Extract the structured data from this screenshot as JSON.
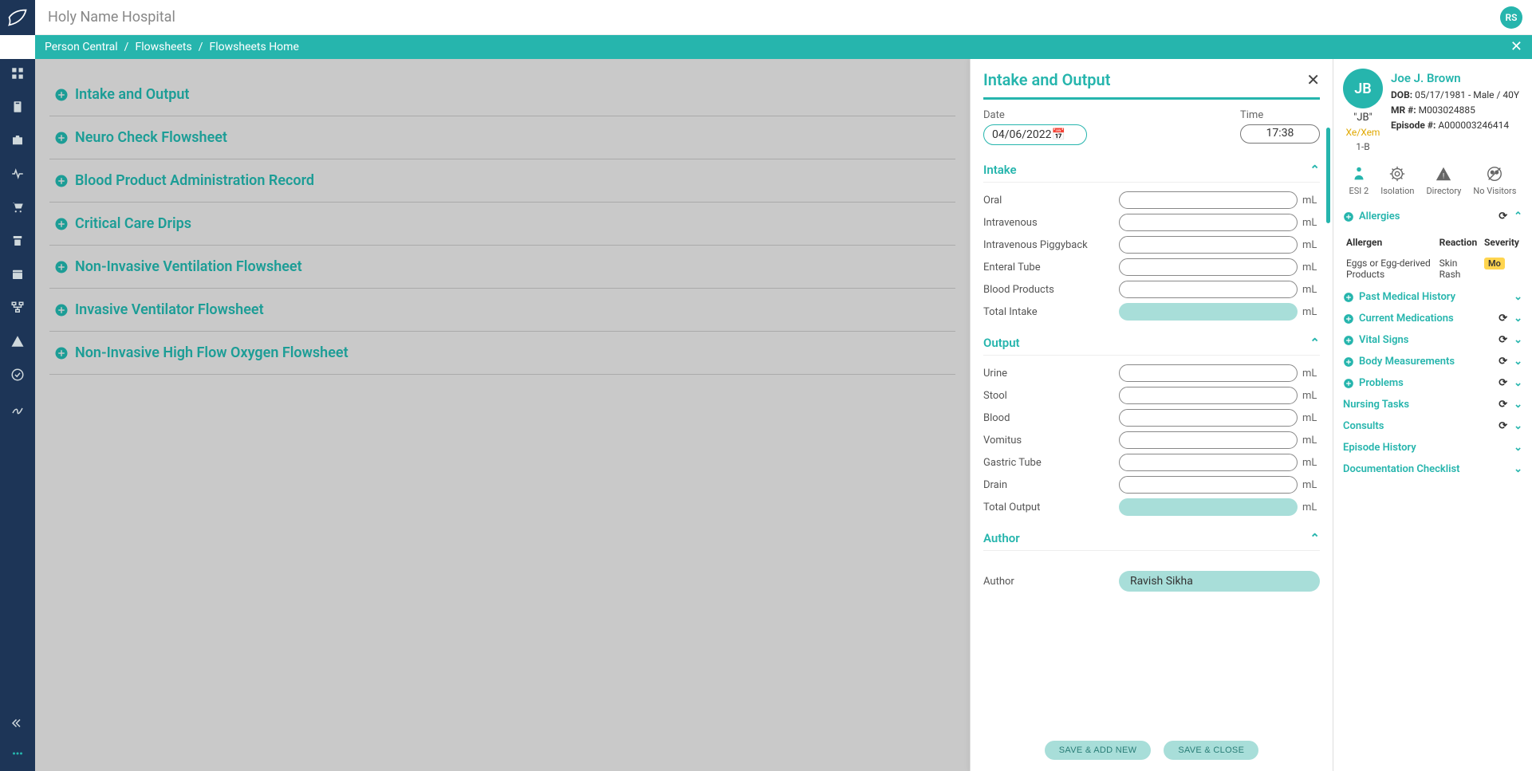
{
  "facility": "Holy Name Hospital",
  "userInitials": "RS",
  "breadcrumb": {
    "a": "Person Central",
    "b": "Flowsheets",
    "c": "Flowsheets Home"
  },
  "flowsheets": [
    "Intake and Output",
    "Neuro Check Flowsheet",
    "Blood Product Administration Record",
    "Critical Care Drips",
    "Non-Invasive Ventilation Flowsheet",
    "Invasive Ventilator Flowsheet",
    "Non-Invasive High Flow Oxygen Flowsheet"
  ],
  "panel": {
    "title": "Intake and Output",
    "dateLabel": "Date",
    "dateValue": "04/06/2022",
    "timeLabel": "Time",
    "timeValue": "17:38",
    "intake": {
      "label": "Intake",
      "rows": [
        {
          "label": "Oral",
          "unit": "mL"
        },
        {
          "label": "Intravenous",
          "unit": "mL"
        },
        {
          "label": "Intravenous Piggyback",
          "unit": "mL"
        },
        {
          "label": "Enteral Tube",
          "unit": "mL"
        },
        {
          "label": "Blood Products",
          "unit": "mL"
        }
      ],
      "totalLabel": "Total Intake",
      "totalUnit": "mL"
    },
    "output": {
      "label": "Output",
      "rows": [
        {
          "label": "Urine",
          "unit": "mL"
        },
        {
          "label": "Stool",
          "unit": "mL"
        },
        {
          "label": "Blood",
          "unit": "mL"
        },
        {
          "label": "Vomitus",
          "unit": "mL"
        },
        {
          "label": "Gastric Tube",
          "unit": "mL"
        },
        {
          "label": "Drain",
          "unit": "mL"
        }
      ],
      "totalLabel": "Total Output",
      "totalUnit": "mL"
    },
    "authorSection": "Author",
    "authorLabel": "Author",
    "authorValue": "Ravish Sikha",
    "saveAddNew": "SAVE & ADD NEW",
    "saveClose": "SAVE & CLOSE"
  },
  "patient": {
    "initials": "JB",
    "name": "Joe J. Brown",
    "dobLabel": "DOB:",
    "dob": "05/17/1981 - Male / 40Y",
    "mrLabel": "MR #:",
    "mr": "M003024885",
    "episodeLabel": "Episode #:",
    "episode": "A000003246414",
    "nickname": "\"JB\"",
    "pronoun": "Xe/Xem",
    "location": "1-B",
    "statusIcons": [
      {
        "label": "ESI 2",
        "name": "esi"
      },
      {
        "label": "Isolation",
        "name": "isolation"
      },
      {
        "label": "Directory",
        "name": "directory"
      },
      {
        "label": "No Visitors",
        "name": "no-visitors"
      }
    ],
    "allergies": {
      "title": "Allergies",
      "cols": {
        "a": "Allergen",
        "b": "Reaction",
        "c": "Severity"
      },
      "rows": [
        {
          "allergen": "Eggs or Egg-derived Products",
          "reaction": "Skin Rash",
          "severity": "Mo"
        }
      ]
    },
    "sections": [
      {
        "label": "Past Medical History",
        "plus": true,
        "refresh": false
      },
      {
        "label": "Current Medications",
        "plus": true,
        "refresh": true
      },
      {
        "label": "Vital Signs",
        "plus": true,
        "refresh": true
      },
      {
        "label": "Body Measurements",
        "plus": true,
        "refresh": true
      },
      {
        "label": "Problems",
        "plus": true,
        "refresh": true
      },
      {
        "label": "Nursing Tasks",
        "plus": false,
        "refresh": true
      },
      {
        "label": "Consults",
        "plus": false,
        "refresh": true
      },
      {
        "label": "Episode History",
        "plus": false,
        "refresh": false
      },
      {
        "label": "Documentation Checklist",
        "plus": false,
        "refresh": false
      }
    ]
  }
}
